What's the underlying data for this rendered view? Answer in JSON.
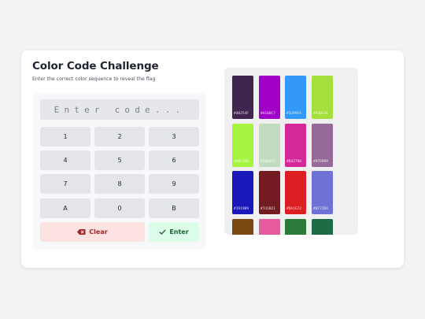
{
  "title": "Color Code Challenge",
  "subtitle": "Enter the correct color sequence to reveal the flag",
  "code_input": {
    "placeholder": "Enter code...",
    "value": ""
  },
  "keys": [
    "1",
    "2",
    "3",
    "4",
    "5",
    "6",
    "7",
    "8",
    "9",
    "A",
    "0",
    "B"
  ],
  "actions": {
    "clear_label": "Clear",
    "enter_label": "Enter"
  },
  "colors": {
    "clear_bg": "#fde2e2",
    "clear_text": "#9b2727",
    "enter_bg": "#dcfce7",
    "enter_text": "#166534"
  },
  "swatches": [
    {
      "hex": "#40254F"
    },
    {
      "hex": "#A100C7"
    },
    {
      "hex": "#3299FA"
    },
    {
      "hex": "#A4DF3E"
    },
    {
      "hex": "#A6F340"
    },
    {
      "hex": "#C0DDC2"
    },
    {
      "hex": "#D42798"
    },
    {
      "hex": "#976999"
    },
    {
      "hex": "#1919B9"
    },
    {
      "hex": "#741B21"
    },
    {
      "hex": "#DA1E22"
    },
    {
      "hex": "#6F72D4"
    },
    {
      "hex": "#7B4A14"
    },
    {
      "hex": "#E55B9E"
    },
    {
      "hex": "#2C7A3A"
    },
    {
      "hex": "#1F6B45"
    }
  ]
}
